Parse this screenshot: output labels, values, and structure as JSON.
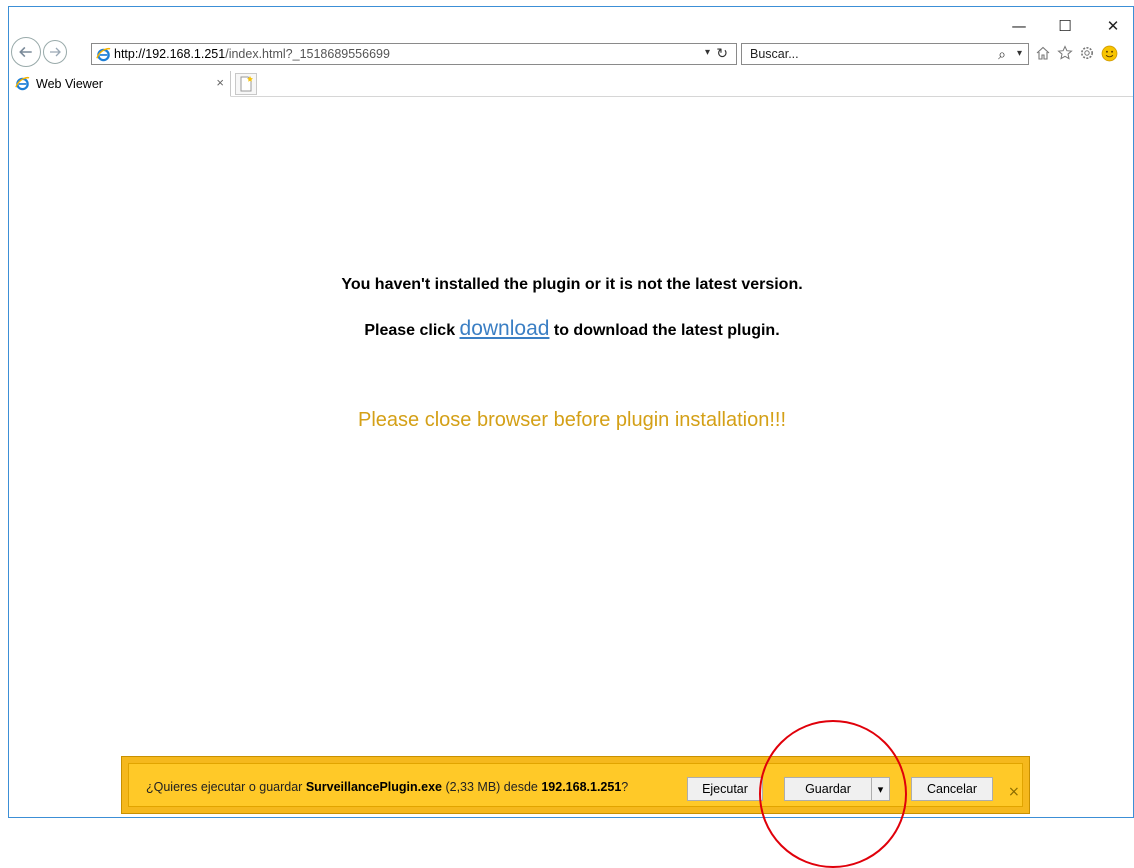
{
  "window": {
    "minimize_glyph": "—",
    "maximize_glyph": "☐",
    "close_glyph": "✕"
  },
  "address": {
    "url_host": "http://192.168.1.251",
    "url_rest": "/index.html?_1518689556699",
    "dropdown_glyph": "▾",
    "refresh_glyph": "↻"
  },
  "search": {
    "placeholder": "Buscar...",
    "icon_glyph": "⌕",
    "dropdown_glyph": "▾"
  },
  "toolbar": {
    "home_icon": "home-icon",
    "favorites_icon": "star-icon",
    "settings_icon": "gear-icon",
    "feedback_icon": "smiley-icon"
  },
  "tabs": [
    {
      "label": "Web Viewer",
      "close_glyph": "×"
    }
  ],
  "content": {
    "line1": "You haven't installed the plugin or it is not the latest version.",
    "line2_prefix": "Please click ",
    "line2_link": "download",
    "line2_suffix": " to download the latest plugin.",
    "warning": "Please close browser before plugin installation!!!"
  },
  "notification": {
    "text_prefix": "¿Quieres ejecutar o guardar ",
    "file_name": "SurveillancePlugin.exe",
    "text_size": " (2,33 MB) desde ",
    "host": "192.168.1.251",
    "text_suffix": "?",
    "run_label": "Ejecutar",
    "save_label": "Guardar",
    "save_dropdown_glyph": "▾",
    "cancel_label": "Cancelar",
    "close_glyph": "×"
  },
  "colors": {
    "warning": "#d4a017",
    "link": "#3b7fc4",
    "notification_bar": "#ffc928",
    "highlight_circle": "#e0000a"
  }
}
